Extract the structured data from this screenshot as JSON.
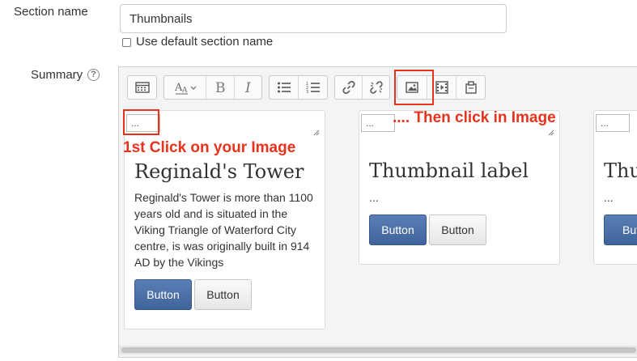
{
  "form": {
    "section_name_label": "Section name",
    "section_name_value": "Thumbnails",
    "use_default_label": "Use default section name",
    "summary_label": "Summary",
    "help_glyph": "?"
  },
  "toolbar": {
    "groups": [
      [
        "toolbar-toggle-icon"
      ],
      [
        "font-style-icon",
        "bold-icon",
        "italic-icon"
      ],
      [
        "unordered-list-icon",
        "ordered-list-icon"
      ],
      [
        "link-icon",
        "unlink-icon"
      ],
      [
        "image-icon",
        "media-icon",
        "manage-files-icon"
      ]
    ]
  },
  "thumbnails": [
    {
      "image_alt": "...",
      "title": "Reginald's Tower",
      "text": "Reginald's Tower is more than 1100 years old and is situated in the Viking Triangle of Waterford City centre, is was originally built in 914 AD by the Vikings",
      "primary_button": "Button",
      "default_button": "Button"
    },
    {
      "image_alt": "...",
      "title": "Thumbnail label",
      "text": "...",
      "primary_button": "Button",
      "default_button": "Button"
    },
    {
      "image_alt": "...",
      "title": "Thu",
      "text": "...",
      "primary_button": "Butt"
    }
  ],
  "annotations": {
    "first_click": "1st Click on your Image",
    "then_click": ".... Then click in Image",
    "color": "#e8321c"
  }
}
